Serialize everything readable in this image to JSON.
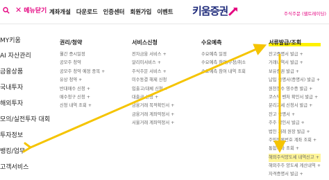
{
  "header": {
    "menu_close": "메뉴닫기",
    "nav": [
      "계좌개설",
      "다운로드",
      "인증센터",
      "회원가입",
      "이벤트"
    ],
    "logo": "키움증권",
    "util": "주식주문 (웹트레이딩)"
  },
  "sidebar": {
    "items": [
      "MY키움",
      "AI 자산관리",
      "금융상품",
      "국내투자",
      "해외투자",
      "모의/실전투자 대회",
      "투자정보",
      "뱅킹/업무",
      "고객서비스"
    ]
  },
  "columns": [
    {
      "title": "권리/청약",
      "items": [
        "월간 증시일정",
        "공모주 청약",
        "공모주 청약 예정 종목 +",
        "유상 청약 +",
        "반대매수 신청 +",
        "매수청구 신청 +",
        "신청 내역 조회 +"
      ]
    },
    {
      "title": "서비스신청",
      "items": [
        "전자금융 서비스 +",
        "알리미서비스 +",
        "주식주문 서비스 +",
        "미수동결 해제 신청",
        "입출고/대체 신청 +",
        "대출금 신청 +",
        "금융거래 목적확인서 +",
        "금융거래 계좌약정서 +",
        "서울거래 계좌약정서 +"
      ]
    },
    {
      "title": "수요예측",
      "items": [
        "수요예측 일정",
        "수요예측 참여/수정/취소",
        "수요예측 참여 내역 조회"
      ]
    },
    {
      "title": "서류발급/조회",
      "items": [
        "잔고증명서 발급 +",
        "거래내역서 발급 +",
        "보유증권 발급 +",
        "납입 증명서(증명서) 발급 +",
        "원천징수 영수증 발급 +",
        "코스닥 벤처 확인서 발급 +",
        "분리과세 신청서 발급 +",
        "잔고 증명서 +",
        "주주 확인서 발급 +",
        "법인 거래 원장 발급 +",
        "주민등록번호 계좌 조회 +",
        "통합계좌 조회 +",
        "해외주식양도세 내역신고 +",
        "해외주주 양도세 계산내역 +",
        "자격증명서 발급 +"
      ]
    }
  ],
  "colors": {
    "accent": "#e4007f",
    "logo": "#1f2b7b",
    "highlight": "#fff200",
    "arrow": "#f5c400"
  }
}
